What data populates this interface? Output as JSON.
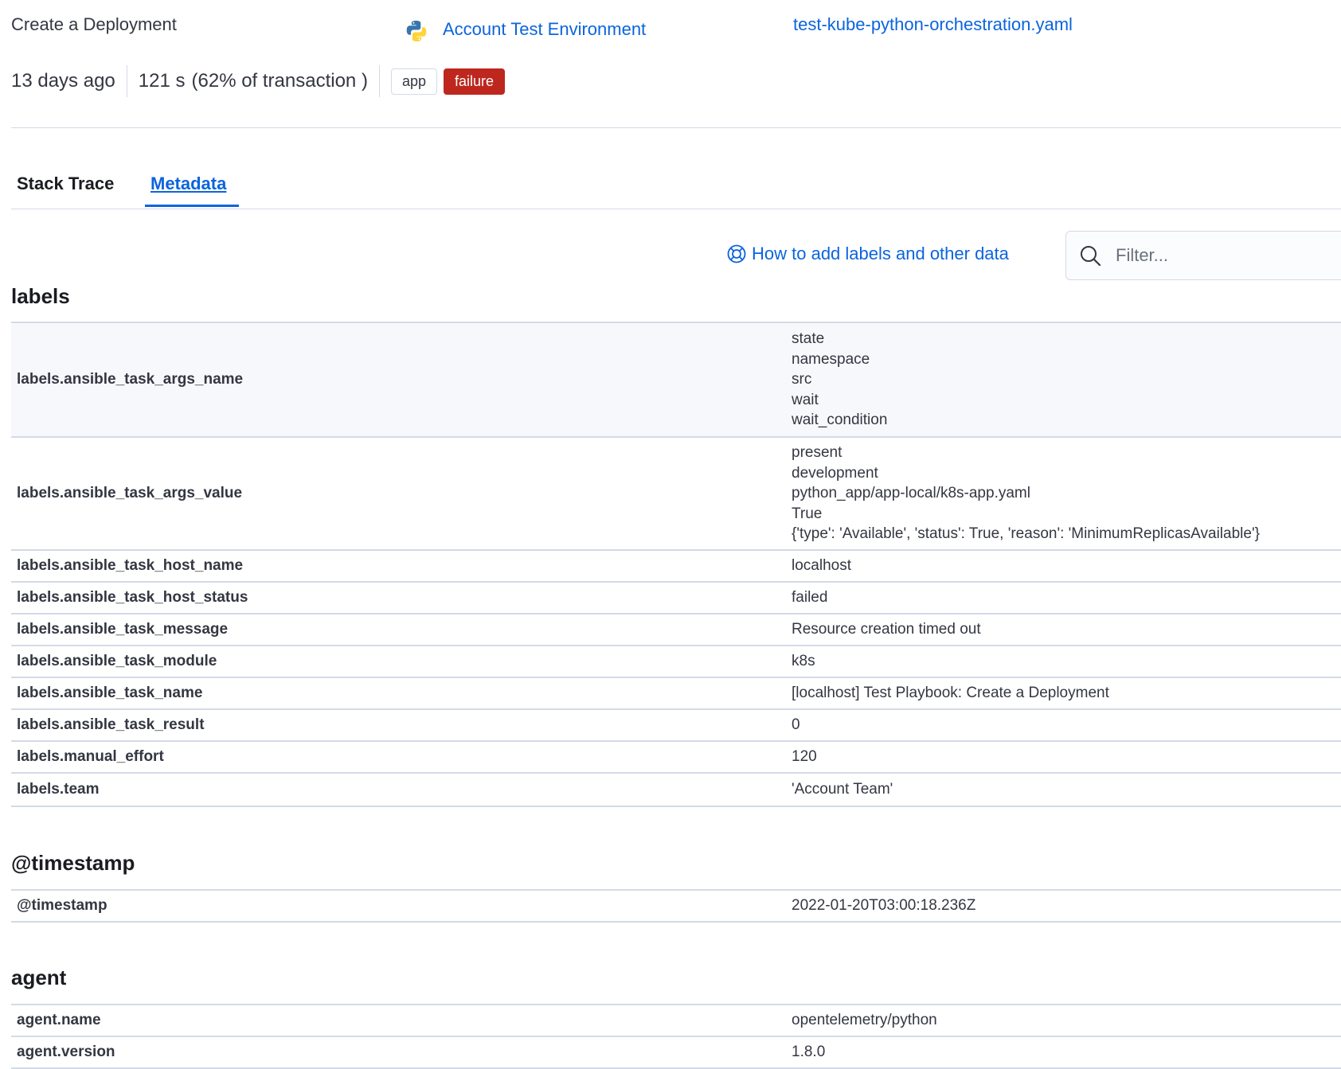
{
  "header": {
    "transaction_name": "Create a Deployment",
    "service_name": "Account Test Environment",
    "service_icon": "python-icon",
    "file_link": "test-kube-python-orchestration.yaml",
    "age": "13 days ago",
    "duration": "121 s",
    "duration_pct": "(62% of transaction )",
    "badges": {
      "app": "app",
      "failure": "failure"
    }
  },
  "tabs": {
    "stack_trace": "Stack Trace",
    "metadata": "Metadata"
  },
  "help": {
    "link_label": "How to add labels and other data",
    "icon": "lifebuoy-icon"
  },
  "filter": {
    "placeholder": "Filter...",
    "icon": "search-icon"
  },
  "sections": {
    "labels": {
      "title": "labels",
      "rows": [
        {
          "key": "labels.ansible_task_args_name",
          "values": [
            "state",
            "namespace",
            "src",
            "wait",
            "wait_condition"
          ]
        },
        {
          "key": "labels.ansible_task_args_value",
          "values": [
            "present",
            "development",
            "python_app/app-local/k8s-app.yaml",
            "True",
            "{'type': 'Available', 'status': True, 'reason': 'MinimumReplicasAvailable'}"
          ]
        },
        {
          "key": "labels.ansible_task_host_name",
          "values": [
            "localhost"
          ]
        },
        {
          "key": "labels.ansible_task_host_status",
          "values": [
            "failed"
          ]
        },
        {
          "key": "labels.ansible_task_message",
          "values": [
            "Resource creation timed out"
          ]
        },
        {
          "key": "labels.ansible_task_module",
          "values": [
            "k8s"
          ]
        },
        {
          "key": "labels.ansible_task_name",
          "values": [
            "[localhost] Test Playbook: Create a Deployment"
          ]
        },
        {
          "key": "labels.ansible_task_result",
          "values": [
            "0"
          ]
        },
        {
          "key": "labels.manual_effort",
          "values": [
            "120"
          ]
        },
        {
          "key": "labels.team",
          "values": [
            "'Account Team'"
          ]
        }
      ]
    },
    "timestamp": {
      "title": "@timestamp",
      "rows": [
        {
          "key": "@timestamp",
          "values": [
            "2022-01-20T03:00:18.236Z"
          ]
        }
      ]
    },
    "agent": {
      "title": "agent",
      "rows": [
        {
          "key": "agent.name",
          "values": [
            "opentelemetry/python"
          ]
        },
        {
          "key": "agent.version",
          "values": [
            "1.8.0"
          ]
        }
      ]
    }
  },
  "colors": {
    "accent": "#0b64dd",
    "danger": "#bd271e",
    "border": "#d3dae6"
  }
}
